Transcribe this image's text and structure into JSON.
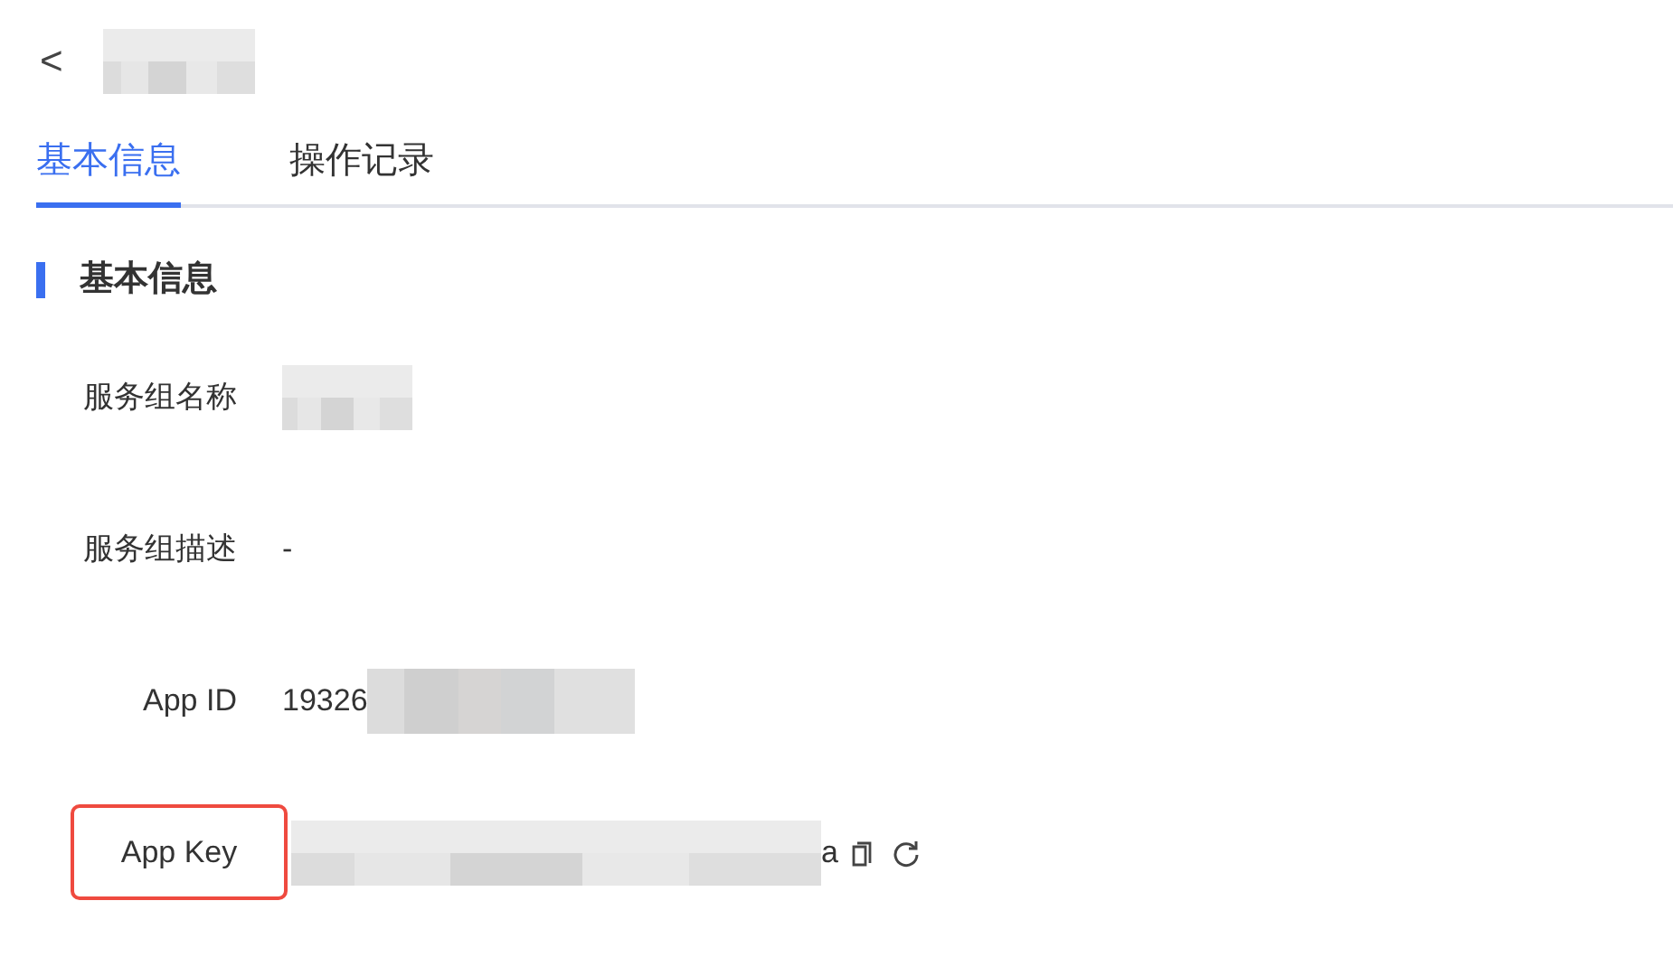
{
  "header": {
    "back": "<",
    "title_redacted": true
  },
  "tabs": [
    {
      "label": "基本信息",
      "selected": true
    },
    {
      "label": "操作记录",
      "selected": false
    }
  ],
  "section": {
    "title": "基本信息"
  },
  "fields": [
    {
      "label": "服务组名称",
      "redacted": true,
      "highlighted": false,
      "actions": false
    },
    {
      "label": "服务组描述",
      "value_prefix": "-",
      "redacted": false,
      "highlighted": false,
      "actions": false
    },
    {
      "label": "App ID",
      "value_prefix": "19326",
      "redacted": true,
      "highlighted": false,
      "actions": false
    },
    {
      "label": "App Key",
      "value_suffix": "a",
      "redacted": true,
      "highlighted": true,
      "actions": true
    }
  ]
}
